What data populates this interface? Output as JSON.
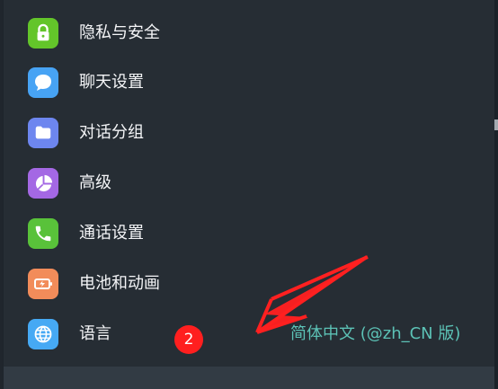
{
  "menu": {
    "items": [
      {
        "label": "隐私与安全",
        "icon": "lock-icon",
        "color": "#63c52a"
      },
      {
        "label": "聊天设置",
        "icon": "chat-bubble-icon",
        "color": "#47a3f4"
      },
      {
        "label": "对话分组",
        "icon": "folder-icon",
        "color": "#6d86ef"
      },
      {
        "label": "高级",
        "icon": "pie-chart-icon",
        "color": "#a468e4"
      },
      {
        "label": "通话设置",
        "icon": "phone-icon",
        "color": "#59c23a"
      },
      {
        "label": "电池和动画",
        "icon": "battery-icon",
        "color": "#f28c5a"
      },
      {
        "label": "语言",
        "icon": "globe-icon",
        "color": "#46a9f4",
        "value": "简体中文 (@zh_CN 版)"
      }
    ]
  },
  "annotation": {
    "badge": "2",
    "badge_color": "#ff1f1f",
    "arrow_color": "#ff2020"
  },
  "theme": {
    "panel": "#262d34",
    "text": "#f4f5f7",
    "accent": "#5cc2b6"
  }
}
